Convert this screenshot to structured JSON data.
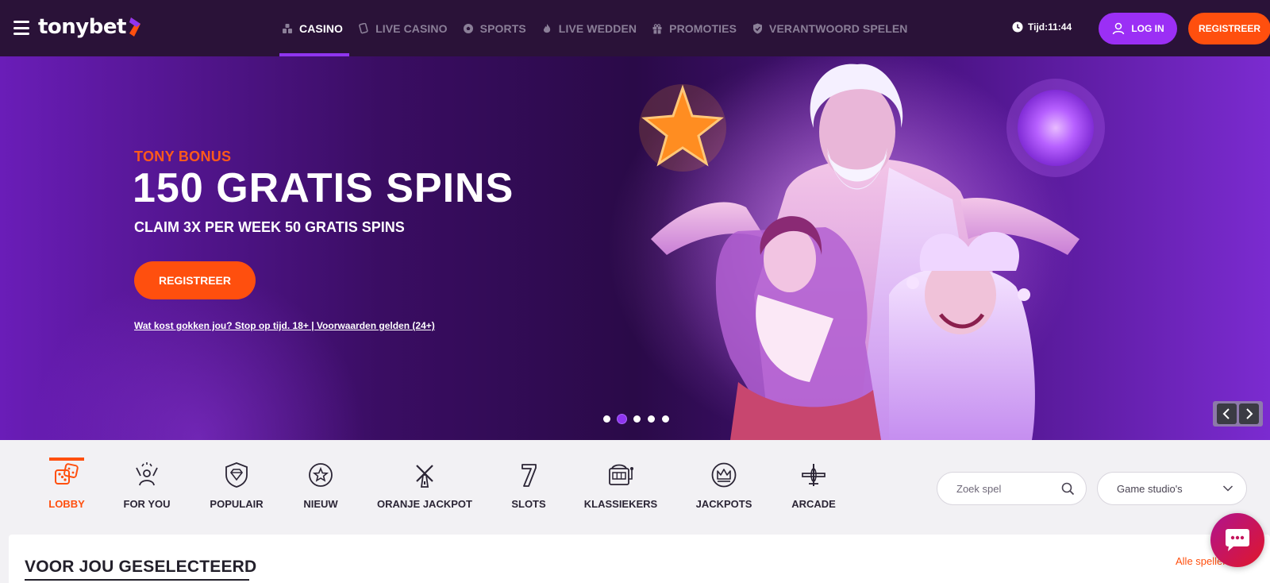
{
  "header": {
    "brand": "tonybet",
    "nav": [
      {
        "label": "CASINO",
        "icon": "casino-icon",
        "active": true
      },
      {
        "label": "LIVE CASINO",
        "icon": "live-casino-icon"
      },
      {
        "label": "SPORTS",
        "icon": "soccer-ball-icon"
      },
      {
        "label": "LIVE WEDDEN",
        "icon": "flame-icon"
      },
      {
        "label": "PROMOTIES",
        "icon": "gift-icon"
      },
      {
        "label": "VERANTWOORD SPELEN",
        "icon": "shield-icon"
      }
    ],
    "clock": "Tijd:11:44",
    "login_label": "LOG IN",
    "register_label": "REGISTREER"
  },
  "hero": {
    "eyebrow": "TONY BONUS",
    "title": "150 GRATIS SPINS",
    "subtitle": "CLAIM 3X PER WEEK 50 GRATIS SPINS",
    "cta": "REGISTREER",
    "disclaimer": "Wat kost gokken jou? Stop op tijd. 18+ | Voorwaarden gelden (24+)",
    "slides_total": 5,
    "active_slide": 2
  },
  "categories": [
    {
      "label": "LOBBY",
      "icon": "dice-icon",
      "active": true
    },
    {
      "label": "FOR YOU",
      "icon": "celebration-icon"
    },
    {
      "label": "POPULAIR",
      "icon": "diamond-badge-icon"
    },
    {
      "label": "NIEUW",
      "icon": "star-badge-icon"
    },
    {
      "label": "ORANJE JACKPOT",
      "icon": "windmill-icon"
    },
    {
      "label": "SLOTS",
      "icon": "lucky-seven-icon"
    },
    {
      "label": "KLASSIEKERS",
      "icon": "slot-machine-icon"
    },
    {
      "label": "JACKPOTS",
      "icon": "crown-icon"
    },
    {
      "label": "ARCADE",
      "icon": "airplane-icon"
    }
  ],
  "search": {
    "placeholder": "Zoek spel"
  },
  "studio_select": {
    "value": "Game studio's"
  },
  "section": {
    "title": "VOOR JOU GESELECTEERD",
    "all_link": "Alle spellen"
  },
  "colors": {
    "accent_orange": "#ff4f0e",
    "accent_purple": "#9b2ff5",
    "header_bg": "#2a1238"
  }
}
